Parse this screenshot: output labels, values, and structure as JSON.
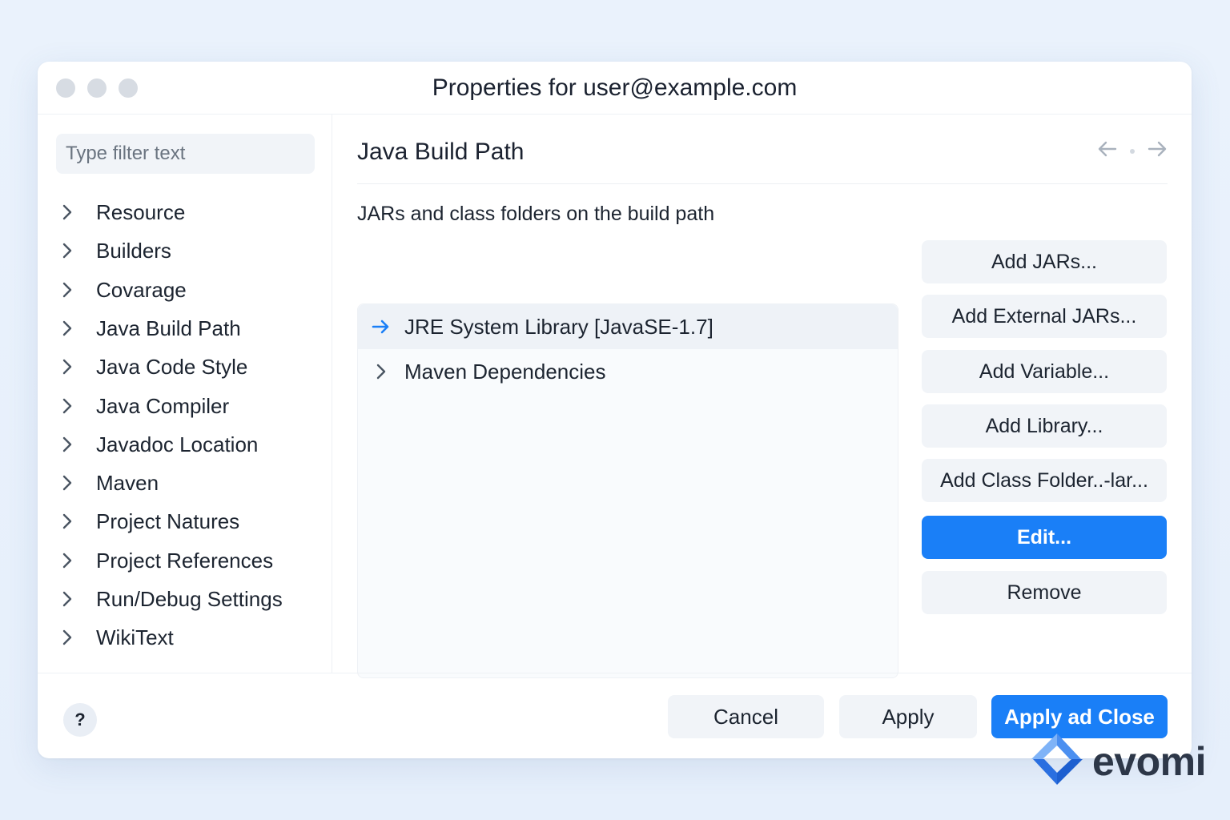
{
  "window": {
    "title": "Properties for user@example.com"
  },
  "sidebar": {
    "filter_placeholder": "Type filter text",
    "items": [
      {
        "label": "Resource"
      },
      {
        "label": "Builders"
      },
      {
        "label": "Covarage"
      },
      {
        "label": "Java Build Path"
      },
      {
        "label": "Java Code Style"
      },
      {
        "label": "Java Compiler"
      },
      {
        "label": "Javadoc Location"
      },
      {
        "label": "Maven"
      },
      {
        "label": "Project Natures"
      },
      {
        "label": "Project References"
      },
      {
        "label": "Run/Debug Settings"
      },
      {
        "label": "WikiText"
      }
    ]
  },
  "main": {
    "title": "Java Build Path",
    "description": "JARs and class folders on the build path",
    "entries": [
      {
        "label": "JRE System Library [JavaSE-1.7]",
        "selected": true
      },
      {
        "label": "Maven Dependencies",
        "selected": false
      }
    ],
    "buttons": {
      "add_jars": "Add JARs...",
      "add_external_jars": "Add External JARs...",
      "add_variable": "Add Variable...",
      "add_library": "Add Library...",
      "add_class_folder": "Add Class Folder..-lar...",
      "edit": "Edit...",
      "remove": "Remove"
    }
  },
  "footer": {
    "help": "?",
    "cancel": "Cancel",
    "apply": "Apply",
    "apply_close": "Apply ad Close"
  },
  "brand": {
    "name": "evomi"
  },
  "colors": {
    "accent": "#1a7ff7",
    "button_bg": "#f1f4f8",
    "background": "#e8f0fb"
  }
}
